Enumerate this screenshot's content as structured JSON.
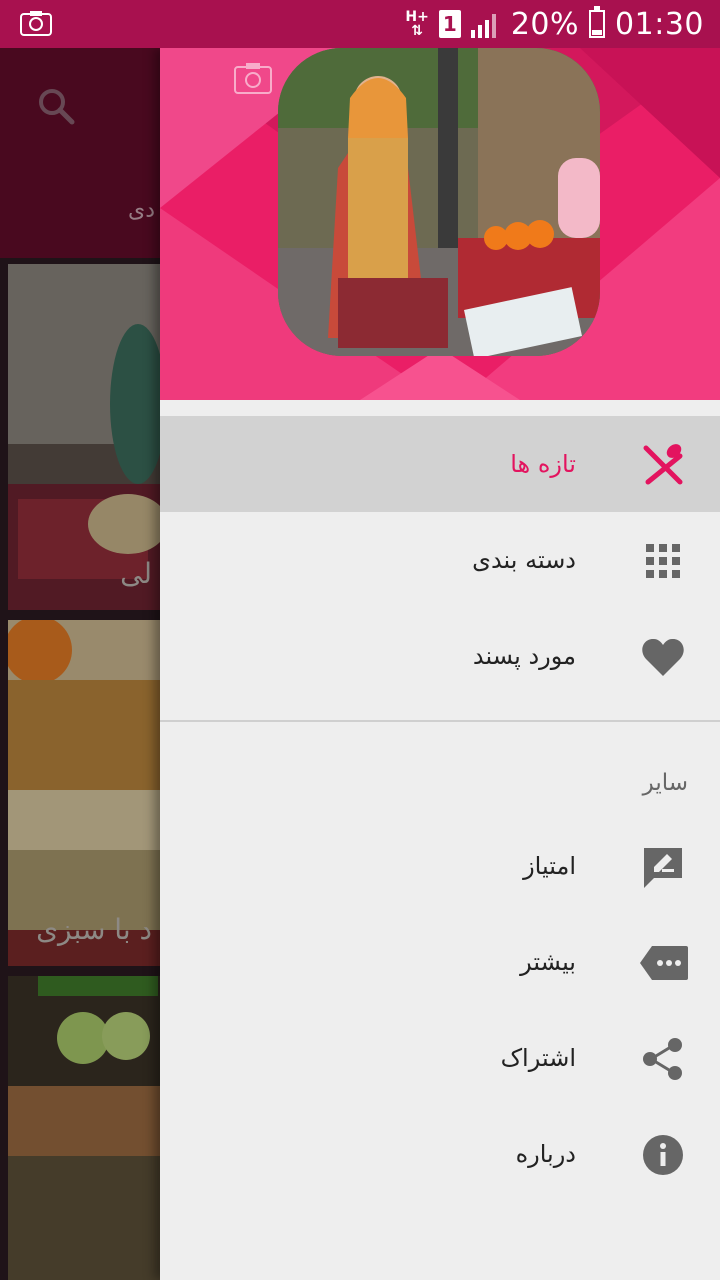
{
  "status_bar": {
    "network": "H+",
    "sim": "1",
    "battery": "20%",
    "battery_level": 0.2,
    "time": "01:30"
  },
  "background": {
    "tab_label": "دی",
    "cards": [
      {
        "caption": "لی"
      },
      {
        "caption": "د با سبزی"
      },
      {
        "caption": ""
      }
    ]
  },
  "drawer": {
    "header_camera_icon": "camera-icon",
    "menu": [
      {
        "label": "تازه ها",
        "icon": "fork-spoon-icon",
        "active": true
      },
      {
        "label": "دسته بندی",
        "icon": "grid-icon",
        "active": false
      },
      {
        "label": "مورد پسند",
        "icon": "heart-icon",
        "active": false
      }
    ],
    "section_title": "سایر",
    "other": [
      {
        "label": "امتیاز",
        "icon": "rate-edit-icon"
      },
      {
        "label": "بیشتر",
        "icon": "more-tag-icon"
      },
      {
        "label": "اشتراک",
        "icon": "share-icon"
      },
      {
        "label": "درباره",
        "icon": "info-icon"
      }
    ]
  },
  "colors": {
    "primary": "#ea1e66",
    "primary_dark": "#a8114f",
    "active_text": "#e3145f",
    "icon_gray": "#666666"
  }
}
